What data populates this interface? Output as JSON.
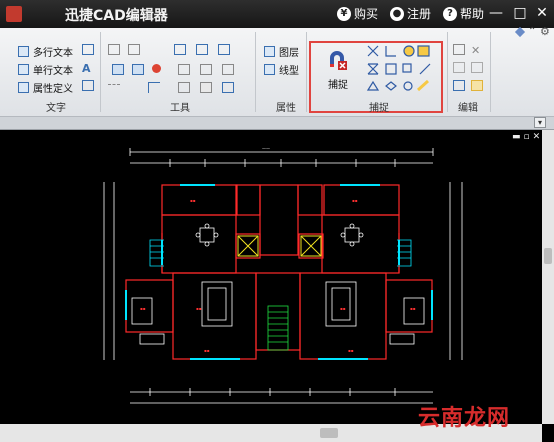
{
  "title_bar": {
    "app_title": "迅捷CAD编辑器",
    "buy_label": "购买",
    "register_label": "注册",
    "help_label": "帮助"
  },
  "ribbon": {
    "text_group": {
      "label": "文字",
      "items": [
        "多行文本",
        "单行文本",
        "属性定义"
      ]
    },
    "tools_group": {
      "label": "工具"
    },
    "properties_group": {
      "label": "属性",
      "items": [
        "图层",
        "线型"
      ]
    },
    "snap_group": {
      "label": "捕捉",
      "button_label": "捕捉"
    },
    "edit_group": {
      "label": "编辑"
    }
  },
  "watermark": "云南龙网",
  "colors": {
    "highlight": "#e0443f",
    "wall": "#ff2a2a",
    "dimension": "#ffffff",
    "window": "#00e5ff",
    "furniture": "#ffffff",
    "label": "#ff3030"
  }
}
